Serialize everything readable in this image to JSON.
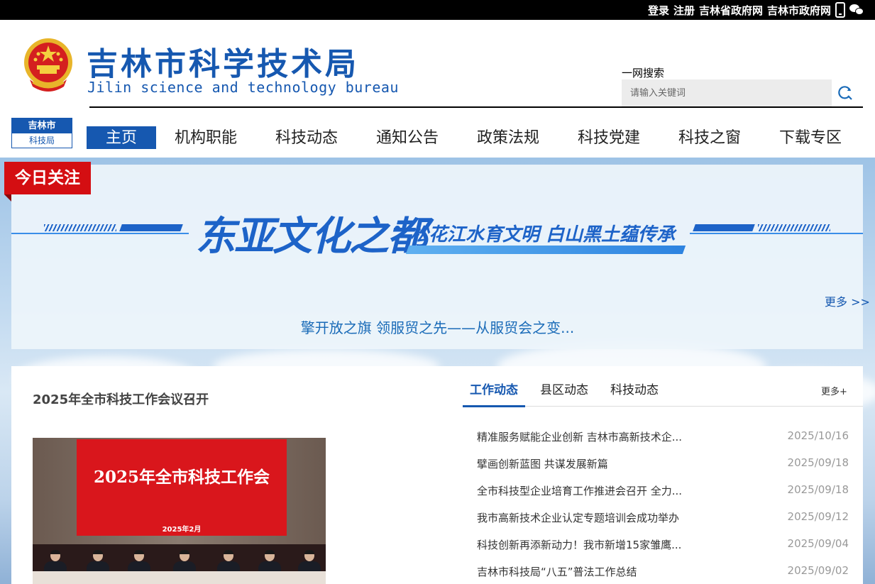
{
  "topbar": {
    "links": [
      "登录",
      "注册",
      "吉林省政府网",
      "吉林市政府网"
    ]
  },
  "header": {
    "title": "吉林市科学技术局",
    "subtitle": "Jilin science and technology bureau",
    "search_label": "一网搜索",
    "search_placeholder": "请输入关键词"
  },
  "badge": {
    "line1": "吉林市",
    "line2": "科技局"
  },
  "nav": {
    "items": [
      "主页",
      "机构职能",
      "科技动态",
      "通知公告",
      "政策法规",
      "科技党建",
      "科技之窗",
      "下载专区"
    ],
    "active": "主页"
  },
  "focus": {
    "tag": "今日关注",
    "slogan_main": "东亚文化之都",
    "slogan_sub": "松花江水育文明 白山黑土蕴传承",
    "more": "更多 >>",
    "headline": "擎开放之旗 领服贸之先——从服贸会之变..."
  },
  "feature": {
    "title": "2025年全市科技工作会议召开",
    "photo_screen_title": "2025年全市科技工作会",
    "photo_screen_date": "2025年2月"
  },
  "news": {
    "tabs": [
      "工作动态",
      "县区动态",
      "科技动态"
    ],
    "active_tab": "工作动态",
    "more": "更多+",
    "items": [
      {
        "title": "精准服务赋能企业创新 吉林市高新技术企...",
        "date": "2025/10/16"
      },
      {
        "title": "擘画创新蓝图 共谋发展新篇",
        "date": "2025/09/18"
      },
      {
        "title": "全市科技型企业培育工作推进会召开 全力...",
        "date": "2025/09/18"
      },
      {
        "title": "我市高新技术企业认定专题培训会成功举办",
        "date": "2025/09/12"
      },
      {
        "title": "科技创新再添新动力！我市新增15家雏鹰...",
        "date": "2025/09/04"
      },
      {
        "title": "吉林市科技局“八五”普法工作总结",
        "date": "2025/09/02"
      }
    ]
  },
  "colors": {
    "brand": "#1658b0",
    "tag_red": "#d40e12",
    "slogan": "#1d63c8"
  }
}
